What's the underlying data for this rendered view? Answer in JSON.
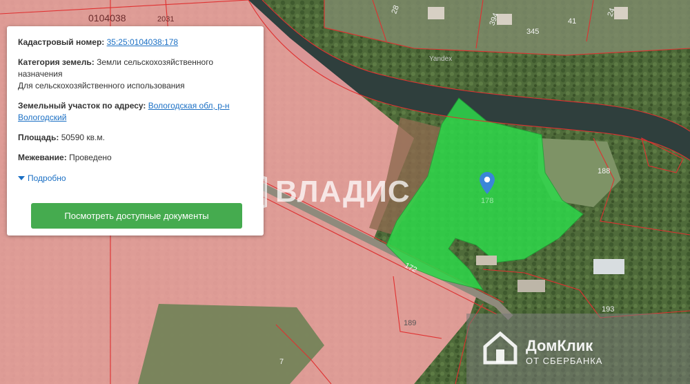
{
  "map": {
    "quarter_label": "0104038",
    "labels": {
      "l2031": "2031",
      "l178": "178",
      "l188": "188",
      "l172": "172",
      "l189": "189",
      "l193": "193",
      "l7": "7",
      "l345": "345",
      "l394": "394",
      "l41": "41",
      "l28": "28",
      "l24": "24",
      "yandex": "Yandex"
    },
    "highlight_color": "#2ed84a",
    "zone_color": "#f2a3a3"
  },
  "card": {
    "cadastral_label": "Кадастровый номер:",
    "cadastral_value": "35:25:0104038:178",
    "category_label": "Категория земель:",
    "category_value_1": "Земли сельскохозяйственного",
    "category_value_2": "назначения",
    "category_value_3": "Для сельскохозяйственного использования",
    "address_label": "Земельный участок по адресу:",
    "address_value_1": "Вологодская обл, р-н",
    "address_value_2": "Вологодский",
    "area_label": "Площадь:",
    "area_value": "50590 кв.м.",
    "survey_label": "Межевание:",
    "survey_value": "Проведено",
    "more_label": "Подробно",
    "button_label": "Посмотреть доступные документы"
  },
  "watermarks": {
    "vladis": "ВЛАДИС",
    "domclick": "ДомКлик",
    "domclick_sub": "ОТ СБЕРБАНКА"
  },
  "colors": {
    "button": "#45ab4f",
    "link": "#1a6fc4",
    "pin": "#3a86d8"
  }
}
